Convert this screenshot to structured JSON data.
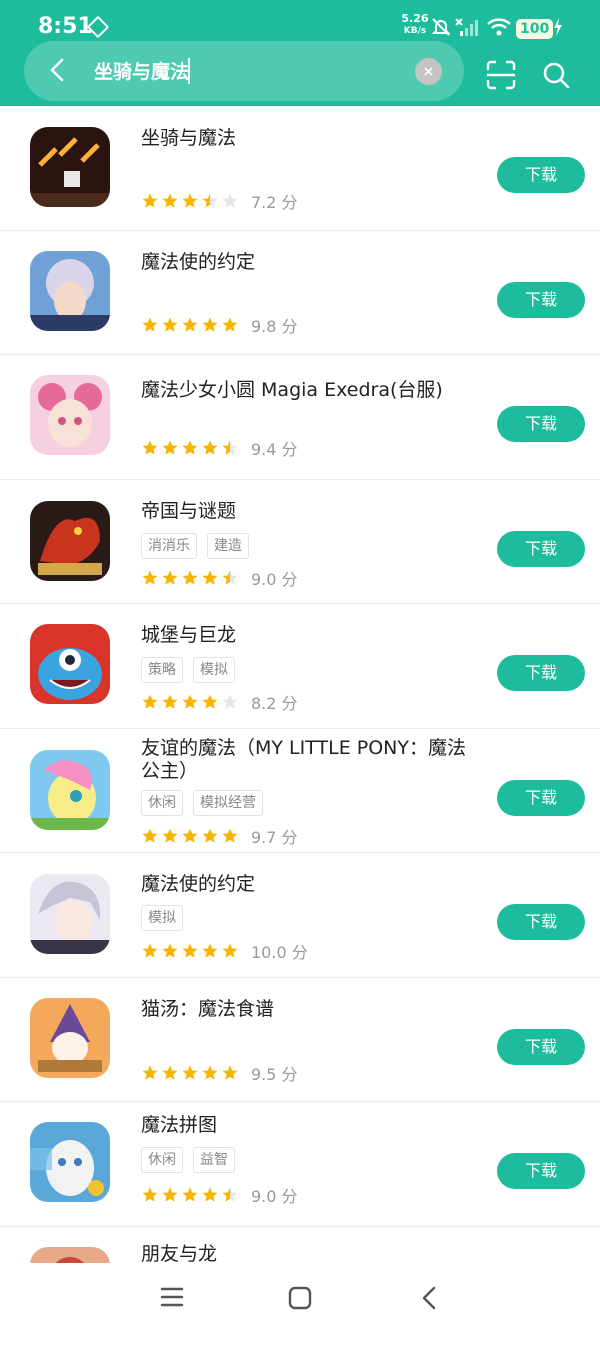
{
  "status": {
    "time": "8:51",
    "net_speed_value": "5.26",
    "net_speed_unit": "KB/s",
    "battery": "100",
    "icons": [
      "diamond-icon",
      "mute-bell-icon",
      "no-signal-icon",
      "signal-icon",
      "wifi-icon",
      "battery-icon",
      "charging-icon"
    ]
  },
  "search": {
    "query": "坐骑与魔法",
    "icons": [
      "back-icon",
      "clear-icon",
      "scan-icon",
      "search-icon"
    ]
  },
  "colors": {
    "accent": "#1dbc9c",
    "star": "#f7b500",
    "star_empty": "#e6e6e6"
  },
  "results": [
    {
      "name": "坐骑与魔法",
      "tags": [],
      "rating": 3.5,
      "score": "7.2 分",
      "button": "下载"
    },
    {
      "name": "魔法使的约定",
      "tags": [],
      "rating": 5,
      "score": "9.8 分",
      "button": "下载"
    },
    {
      "name": "魔法少女小圆 Magia Exedra(台服)",
      "tags": [],
      "rating": 4.5,
      "score": "9.4 分",
      "button": "下载"
    },
    {
      "name": "帝国与谜题",
      "tags": [
        "消消乐",
        "建造"
      ],
      "rating": 4.5,
      "score": "9.0 分",
      "button": "下载"
    },
    {
      "name": "城堡与巨龙",
      "tags": [
        "策略",
        "模拟"
      ],
      "rating": 4,
      "score": "8.2 分",
      "button": "下载"
    },
    {
      "name": "友谊的魔法（MY LITTLE PONY：魔法公主）",
      "tags": [
        "休闲",
        "模拟经营"
      ],
      "rating": 5,
      "score": "9.7 分",
      "button": "下载"
    },
    {
      "name": "魔法使的约定",
      "tags": [
        "模拟"
      ],
      "rating": 5,
      "score": "10.0 分",
      "button": "下载"
    },
    {
      "name": "猫汤：魔法食谱",
      "tags": [],
      "rating": 5,
      "score": "9.5 分",
      "button": "下载"
    },
    {
      "name": "魔法拼图",
      "tags": [
        "休闲",
        "益智"
      ],
      "rating": 4.5,
      "score": "9.0 分",
      "button": "下载"
    },
    {
      "name": "朋友与龙",
      "tags": [],
      "rating": 0,
      "score": "",
      "button": ""
    }
  ],
  "navbar": {
    "icons": [
      "menu-icon",
      "home-icon",
      "back-nav-icon"
    ]
  }
}
